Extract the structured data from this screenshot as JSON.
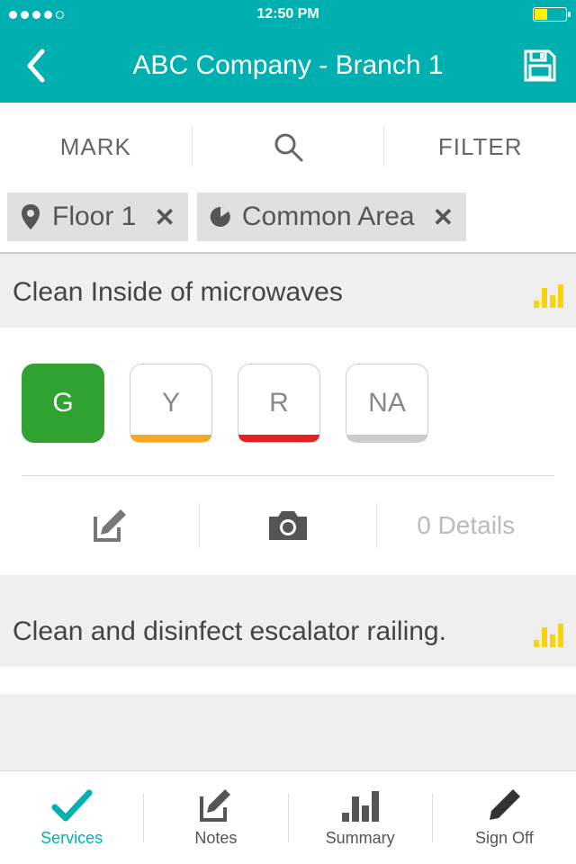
{
  "status": {
    "time": "12:50 PM"
  },
  "header": {
    "title": "ABC Company - Branch 1"
  },
  "toolbar": {
    "mark": "MARK",
    "filter": "FILTER"
  },
  "chips": [
    {
      "icon": "pin",
      "label": "Floor 1"
    },
    {
      "icon": "pie",
      "label": "Common Area"
    }
  ],
  "tasks": [
    {
      "title": "Clean Inside of microwaves",
      "ratings": {
        "g": "G",
        "y": "Y",
        "r": "R",
        "na": "NA"
      },
      "details": "0 Details"
    },
    {
      "title": "Clean and disinfect escalator railing."
    }
  ],
  "nav": {
    "services": "Services",
    "notes": "Notes",
    "summary": "Summary",
    "signoff": "Sign Off"
  }
}
